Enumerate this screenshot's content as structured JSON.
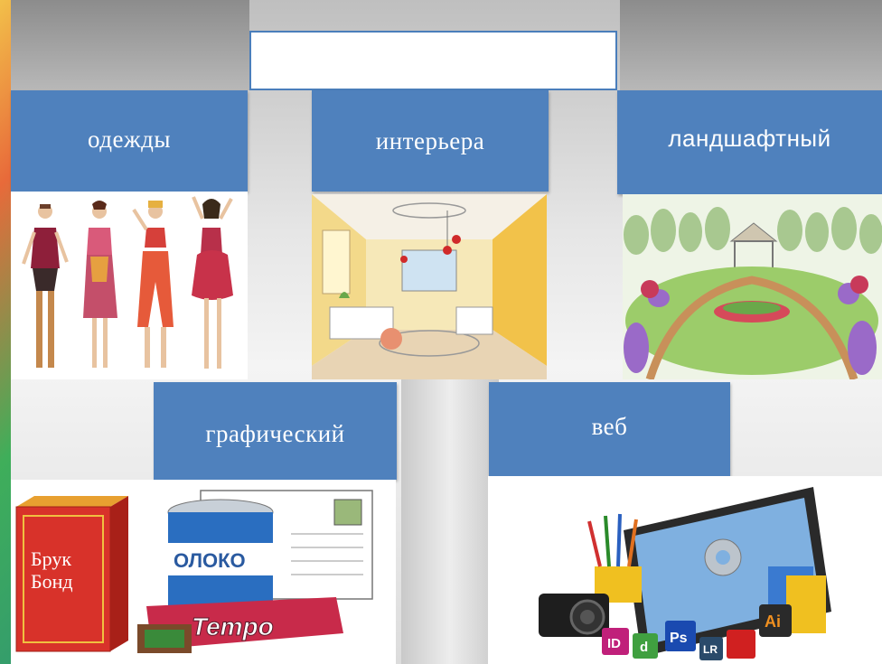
{
  "title_box": "",
  "categories": {
    "clothing": "одежды",
    "interior": "интерьера",
    "landscape": "ландшафтный",
    "graphic": "графический",
    "web": "веб"
  },
  "graphic_image": {
    "box_text_1": "Брук",
    "box_text_2": "Бонд",
    "can_text": "ОЛОКО",
    "bar_text": "Tempo"
  },
  "web_image": {
    "badges": [
      "ID",
      "d",
      "Ps",
      "LR",
      "Ai"
    ]
  }
}
